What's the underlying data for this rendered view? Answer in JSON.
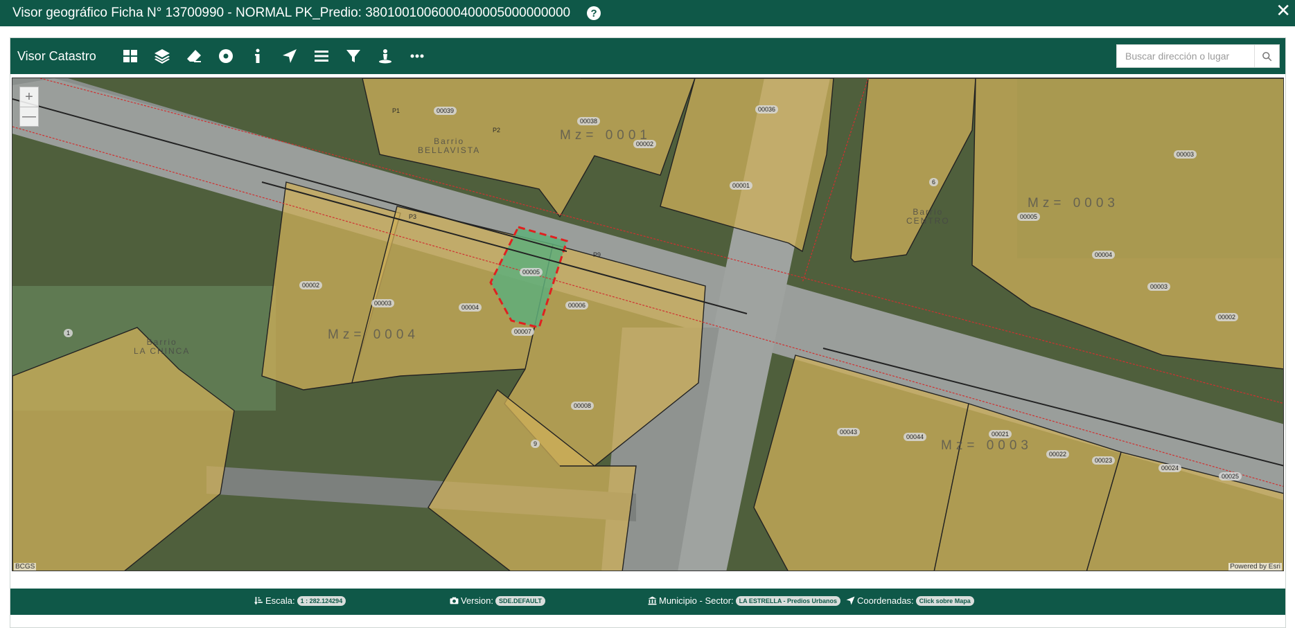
{
  "window": {
    "title": "Visor geográfico Ficha N° 13700990 - NORMAL PK_Predio: 3801001006000400005000000000",
    "help_icon": "?",
    "close_icon": "✕"
  },
  "toolbar": {
    "app_name": "Visor Catastro",
    "tools": [
      "grid-icon",
      "layers-icon",
      "eraser-icon",
      "target-icon",
      "info-icon",
      "navigate-icon",
      "list-icon",
      "filter-icon",
      "person-pin-icon",
      "more-icon"
    ]
  },
  "search": {
    "placeholder": "Buscar dirección o lugar"
  },
  "map": {
    "zoom_in": "+",
    "zoom_out": "—",
    "attribution_left": "BCGS",
    "attribution_right": "Powered by Esri",
    "manzanas": [
      "Mz= 0001",
      "Mz= 0004",
      "Mz= 0003",
      "Mz= 0003"
    ],
    "barrios": [
      {
        "name": "Barrio",
        "sub": "BELLAVISTA"
      },
      {
        "name": "Barrio",
        "sub": "LA CHINCA"
      },
      {
        "name": "Barrio",
        "sub": "CENTRO"
      }
    ],
    "lots": [
      "00039",
      "00038",
      "00002",
      "00036",
      "00001",
      "00005",
      "00002",
      "00003",
      "00004",
      "00005",
      "00006",
      "00007",
      "00008",
      "00043",
      "00044",
      "00021",
      "00022",
      "00023",
      "00024",
      "00025",
      "00004",
      "00003",
      "00002",
      "00003",
      "1",
      "6",
      "9"
    ],
    "parts": [
      "P1",
      "P2",
      "P3",
      "P9"
    ],
    "highlight_colors": {
      "selected_fill": "#5fae7a",
      "selected_border": "#e02020"
    }
  },
  "footer": {
    "scale_label": "Escala:",
    "scale_value": "1 : 282.124294",
    "version_label": "Version:",
    "version_value": "SDE.DEFAULT",
    "municipio_label": "Municipio - Sector:",
    "municipio_value": "LA ESTRELLA - Predios Urbanos",
    "coords_label": "Coordenadas:",
    "coords_value": "Click sobre Mapa"
  }
}
